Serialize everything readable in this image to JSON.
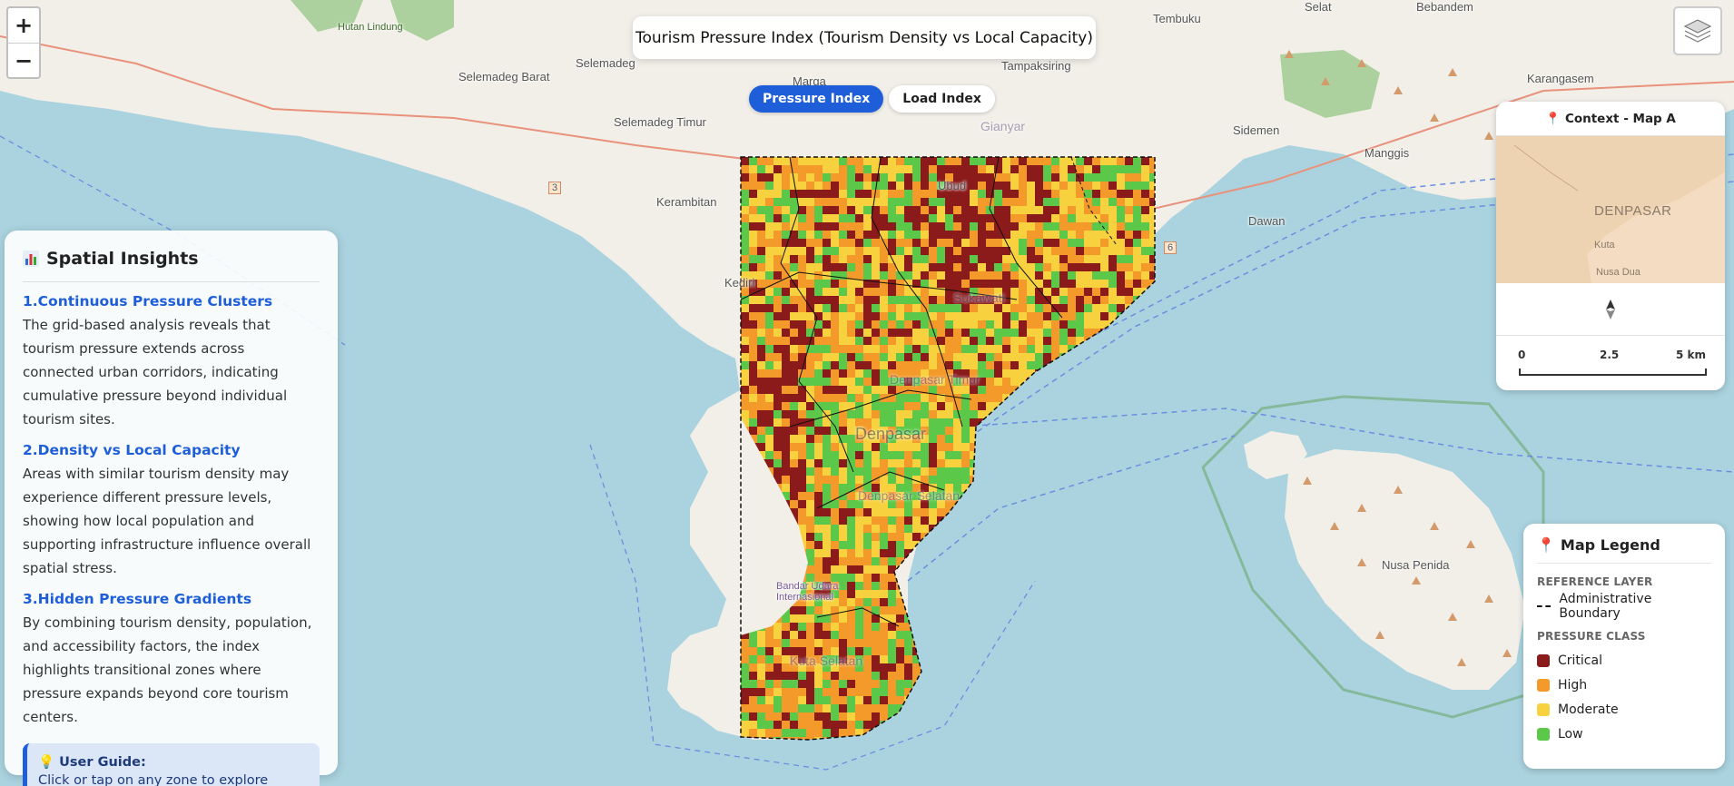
{
  "map": {
    "labels": [
      {
        "text": "Hutan Lindung",
        "cls": "green"
      },
      {
        "text": "Selemadeg Barat",
        "cls": ""
      },
      {
        "text": "Selemadeg",
        "cls": ""
      },
      {
        "text": "Selemadeg Timur",
        "cls": ""
      },
      {
        "text": "Kerambitan",
        "cls": ""
      },
      {
        "text": "Kediri",
        "cls": ""
      },
      {
        "text": "Marga",
        "cls": ""
      },
      {
        "text": "Tampaksiring",
        "cls": ""
      },
      {
        "text": "Gianyar",
        "cls": "district"
      },
      {
        "text": "Tembuku",
        "cls": ""
      },
      {
        "text": "Selat",
        "cls": ""
      },
      {
        "text": "Bebandem",
        "cls": ""
      },
      {
        "text": "Karangasem",
        "cls": ""
      },
      {
        "text": "Sidemen",
        "cls": ""
      },
      {
        "text": "Manggis",
        "cls": ""
      },
      {
        "text": "Dawan",
        "cls": ""
      },
      {
        "text": "Ubud",
        "cls": ""
      },
      {
        "text": "Sukawati",
        "cls": "district"
      },
      {
        "text": "Denpasar Timur",
        "cls": "district"
      },
      {
        "text": "Denpasar",
        "cls": "big"
      },
      {
        "text": "Denpasar Selatan",
        "cls": "district"
      },
      {
        "text": "Kuta Selatan",
        "cls": "district"
      },
      {
        "text": "Nusa Penida",
        "cls": ""
      },
      {
        "text": "Bandar Udara Internasional",
        "cls": "purple"
      },
      {
        "text": "3",
        "cls": ""
      },
      {
        "text": "6",
        "cls": ""
      }
    ],
    "colors": {
      "critical": "#8b1a1a",
      "high": "#f39a2b",
      "moderate": "#f7d23e",
      "low": "#5cc84a"
    }
  },
  "zoom": {
    "in": "+",
    "out": "−"
  },
  "title": "Tourism Pressure Index (Tourism Density vs Local Capacity)",
  "toggle": {
    "pressure": "Pressure Index",
    "load": "Load Index"
  },
  "insights": {
    "title": "Spatial Insights",
    "items": [
      {
        "head": "1.Continuous Pressure Clusters",
        "body": "The grid-based analysis reveals that tourism pressure extends across connected urban corridors, indicating cumulative pressure beyond individual tourism sites."
      },
      {
        "head": "2.Density vs Local Capacity",
        "body": "Areas with similar tourism density may experience different pressure levels, showing how local population and supporting infrastructure influence overall spatial stress."
      },
      {
        "head": "3.Hidden Pressure Gradients",
        "body": "By combining tourism density, population, and accessibility factors, the index highlights transitional zones where pressure expands beyond core tourism centers."
      }
    ],
    "guide_head": "User Guide:",
    "guide_body": "Click or tap on any zone to explore details."
  },
  "context": {
    "title": "Context - Map A",
    "labels": {
      "denpasar": "DENPASAR",
      "kuta": "Kuta",
      "nusadua": "Nusa Dua"
    },
    "scale": {
      "s0": "0",
      "s1": "2.5",
      "s2": "5 km"
    }
  },
  "legend": {
    "title": "Map Legend",
    "ref_section": "REFERENCE LAYER",
    "admin": "Administrative Boundary",
    "class_section": "PRESSURE CLASS",
    "classes": [
      "Critical",
      "High",
      "Moderate",
      "Low"
    ]
  }
}
